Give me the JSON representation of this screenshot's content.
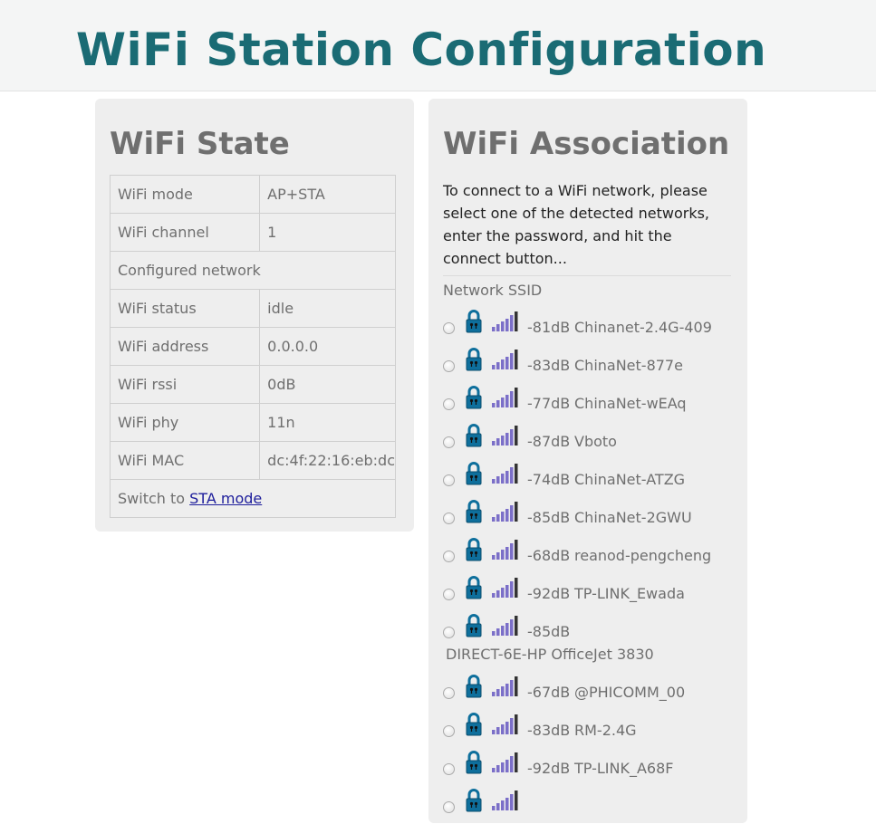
{
  "page": {
    "title": "WiFi Station Configuration"
  },
  "state": {
    "heading": "WiFi State",
    "rows": [
      {
        "label": "WiFi mode",
        "value": "AP+STA"
      },
      {
        "label": "WiFi channel",
        "value": "1"
      },
      {
        "label": "Configured network",
        "value": ""
      },
      {
        "label": "WiFi status",
        "value": "idle"
      },
      {
        "label": "WiFi address",
        "value": "0.0.0.0"
      },
      {
        "label": "WiFi rssi",
        "value": "0dB"
      },
      {
        "label": "WiFi phy",
        "value": "11n"
      },
      {
        "label": "WiFi MAC",
        "value": "dc:4f:22:16:eb:dc"
      }
    ],
    "switch_text": "Switch to ",
    "switch_link": "STA mode"
  },
  "association": {
    "heading": "WiFi Association",
    "intro": "To connect to a WiFi network, please select one of the detected networks, enter the password, and hit the connect button...",
    "ssid_label": "Network SSID",
    "networks": [
      {
        "rssi": "-81dB",
        "ssid": "Chinanet-2.4G-409"
      },
      {
        "rssi": "-83dB",
        "ssid": "ChinaNet-877e"
      },
      {
        "rssi": "-77dB",
        "ssid": "ChinaNet-wEAq"
      },
      {
        "rssi": "-87dB",
        "ssid": "Vboto"
      },
      {
        "rssi": "-74dB",
        "ssid": "ChinaNet-ATZG"
      },
      {
        "rssi": "-85dB",
        "ssid": "ChinaNet-2GWU"
      },
      {
        "rssi": "-68dB",
        "ssid": "reanod-pengcheng"
      },
      {
        "rssi": "-92dB",
        "ssid": "TP-LINK_Ewada"
      },
      {
        "rssi": "-85dB",
        "ssid": "DIRECT-6E-HP OfficeJet 3830"
      },
      {
        "rssi": "-67dB",
        "ssid": "@PHICOMM_00"
      },
      {
        "rssi": "-83dB",
        "ssid": "RM-2.4G"
      },
      {
        "rssi": "-92dB",
        "ssid": "TP-LINK_A68F"
      },
      {
        "rssi": "",
        "ssid": ""
      }
    ]
  },
  "colors": {
    "title": "#1a6b74",
    "lock": "#0e6f9c",
    "signal_bars": "#7b6fc8",
    "signal_bar_dark": "#333333",
    "link": "#1d1d9b"
  },
  "icons": {
    "lock": "lock-icon",
    "signal": "signal-strength-icon",
    "radio": "radio-button"
  }
}
